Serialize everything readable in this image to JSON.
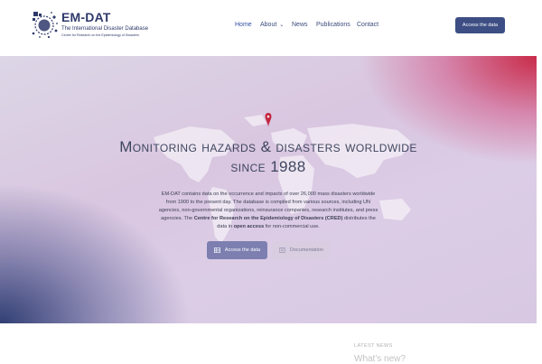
{
  "header": {
    "logo": {
      "title": "EM-DAT",
      "subtitle": "The International Disaster Database",
      "org": "Centre for Research on the Epidemiology of Disasters"
    },
    "nav": [
      {
        "label": "Home",
        "active": true
      },
      {
        "label": "About",
        "has_dropdown": true
      },
      {
        "label": "News"
      },
      {
        "label": "Publications"
      },
      {
        "label": "Contact"
      }
    ],
    "access_button": "Access the data"
  },
  "hero": {
    "title_line1": "Monitoring hazards & disasters worldwide",
    "title_line2": "since 1988",
    "description": {
      "part1": "EM-DAT contains data on the occurrence and impacts of over 26,000 mass disasters worldwide from 1900 to the present day. The database is compiled from various sources, including UN agencies, non-governmental organizations, reinsurance companies, research institutes, and press agencies. The ",
      "bold1": "Centre for Research on the Epidemiology of Disasters (CRED)",
      "part2": " distributes the data in ",
      "bold2": "open access",
      "part3": " for non-commercial use."
    },
    "primary_button": "Access the data",
    "secondary_button": "Documentation"
  },
  "latest_news": {
    "heading": "LATEST NEWS",
    "title": "What's new?"
  },
  "colors": {
    "brand": "#2f3a6b",
    "button": "#3d4e84",
    "pin": "#c4243f"
  }
}
